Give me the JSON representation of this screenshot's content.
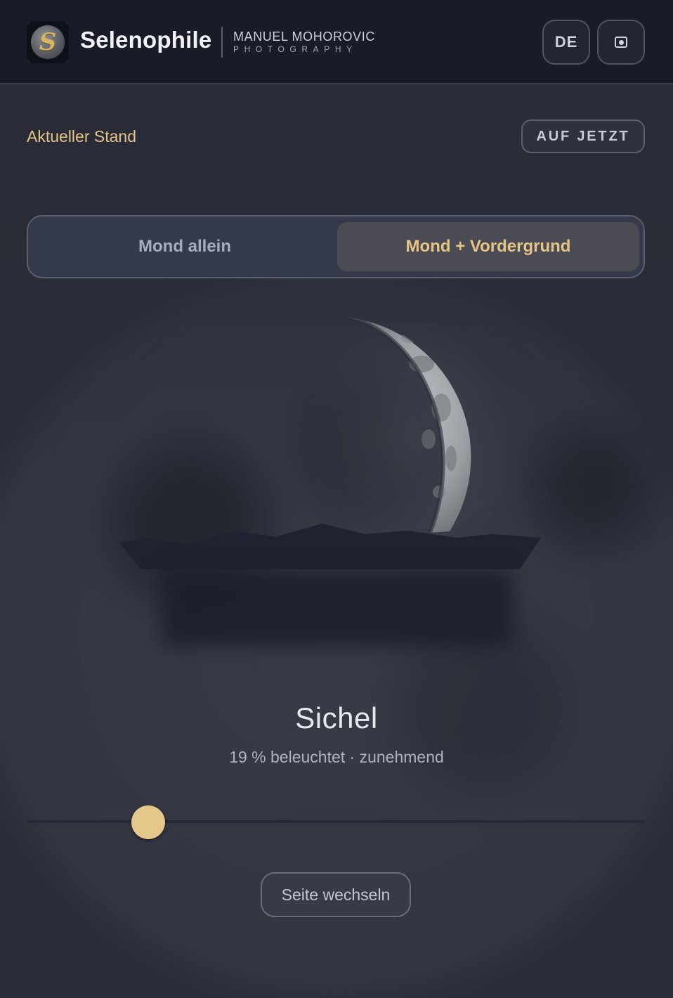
{
  "header": {
    "logo_letter": "S",
    "brand": "Selenophile",
    "photographer_name": "MANUEL MOHOROVIC",
    "photographer_sub": "PHOTOGRAPHY",
    "language": "DE",
    "camera_icon": "camera-icon"
  },
  "status": {
    "label": "Aktueller Stand",
    "now_button": "AUF JETZT"
  },
  "view_toggle": {
    "options": [
      "Mond allein",
      "Mond + Vordergrund"
    ],
    "selected": "Mond + Vordergrund"
  },
  "moon": {
    "phase_name": "Sichel",
    "detail": "19 % beleuchtet · zunehmend",
    "illumination_percent": 19,
    "waxing": true
  },
  "slider": {
    "value_fraction": 0.197
  },
  "footer": {
    "switch_button": "Seite wechseln"
  },
  "colors": {
    "accent": "#e5c78c",
    "header_bg": "#191c28",
    "page_bg": "#2b2e38"
  }
}
